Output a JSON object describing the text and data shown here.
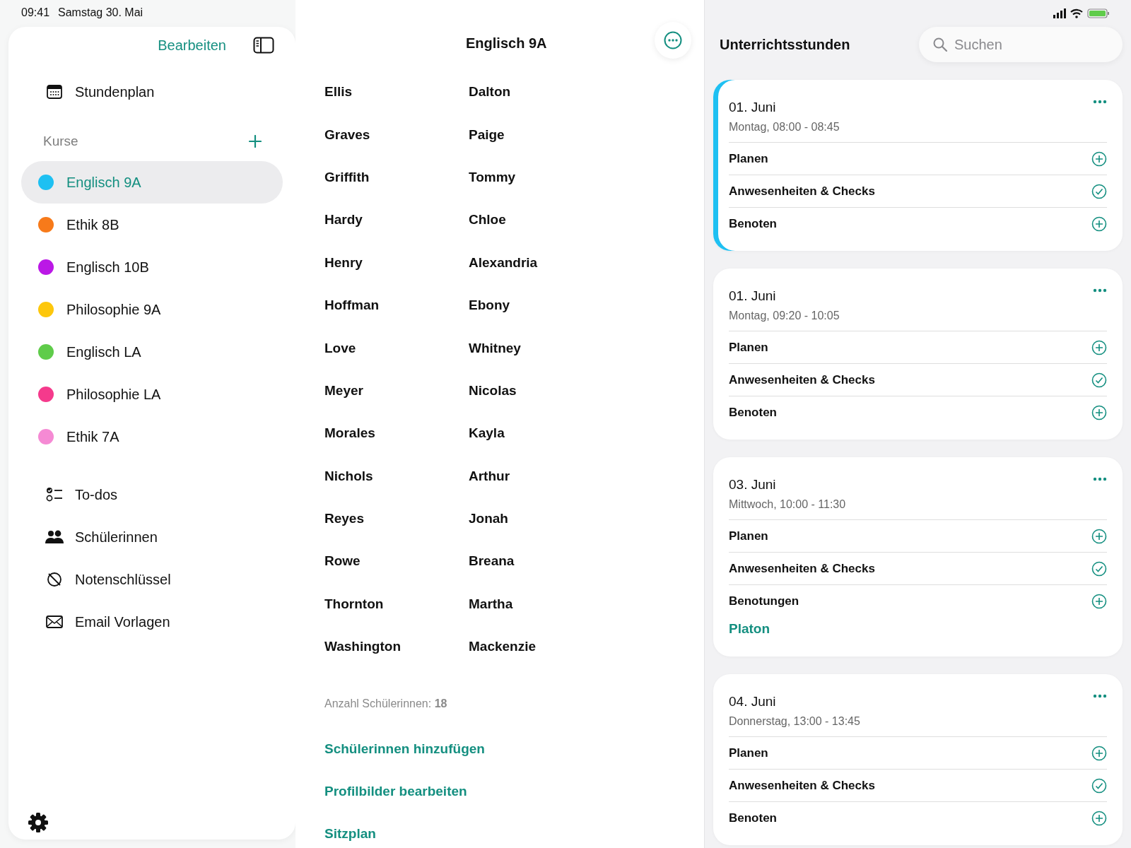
{
  "status_bar": {
    "time": "09:41",
    "date": "Samstag 30. Mai"
  },
  "sidebar": {
    "edit_button": "Bearbeiten",
    "schedule": {
      "label": "Stundenplan"
    },
    "courses_heading": "Kurse",
    "courses": [
      {
        "label": "Englisch 9A",
        "color": "#1ec0f2",
        "selected": true
      },
      {
        "label": "Ethik 8B",
        "color": "#f77a1a",
        "selected": false
      },
      {
        "label": "Englisch 10B",
        "color": "#bb18e6",
        "selected": false
      },
      {
        "label": "Philosophie 9A",
        "color": "#fdc70c",
        "selected": false
      },
      {
        "label": "Englisch LA",
        "color": "#5fcc4a",
        "selected": false
      },
      {
        "label": "Philosophie LA",
        "color": "#f53a8c",
        "selected": false
      },
      {
        "label": "Ethik 7A",
        "color": "#f58ad4",
        "selected": false
      }
    ],
    "nav": [
      {
        "label": "To-dos"
      },
      {
        "label": "Schülerinnen"
      },
      {
        "label": "Notenschlüssel"
      },
      {
        "label": "Email Vorlagen"
      }
    ]
  },
  "course": {
    "title": "Englisch 9A",
    "students": [
      {
        "last": "Ellis",
        "first": "Dalton"
      },
      {
        "last": "Graves",
        "first": "Paige"
      },
      {
        "last": "Griffith",
        "first": "Tommy"
      },
      {
        "last": "Hardy",
        "first": "Chloe"
      },
      {
        "last": "Henry",
        "first": "Alexandria"
      },
      {
        "last": "Hoffman",
        "first": "Ebony"
      },
      {
        "last": "Love",
        "first": "Whitney"
      },
      {
        "last": "Meyer",
        "first": "Nicolas"
      },
      {
        "last": "Morales",
        "first": "Kayla"
      },
      {
        "last": "Nichols",
        "first": "Arthur"
      },
      {
        "last": "Reyes",
        "first": "Jonah"
      },
      {
        "last": "Rowe",
        "first": "Breana"
      },
      {
        "last": "Thornton",
        "first": "Martha"
      },
      {
        "last": "Washington",
        "first": "Mackenzie"
      }
    ],
    "count": "Anzahl Schülerinnen: **18**",
    "links": [
      "Schülerinnen hinzufügen",
      "Profilbilder bearbeiten",
      "Sitzplan"
    ]
  },
  "lessons": {
    "title": "Unterrichtsstunden",
    "search": {
      "placeholder": "Suchen"
    },
    "cards": [
      {
        "date": "01. Juni",
        "time": "Montag, 08:00 - 08:45",
        "selected": true,
        "actions": [
          {
            "label": "Planen",
            "kind": "add"
          },
          {
            "label": "Anwesenheiten & Checks",
            "kind": "check"
          },
          {
            "label": "Benoten",
            "kind": "add"
          }
        ]
      },
      {
        "date": "01. Juni",
        "time": "Montag, 09:20 - 10:05",
        "selected": false,
        "actions": [
          {
            "label": "Planen",
            "kind": "add"
          },
          {
            "label": "Anwesenheiten & Checks",
            "kind": "check"
          },
          {
            "label": "Benoten",
            "kind": "add"
          }
        ]
      },
      {
        "date": "03. Juni",
        "time": "Mittwoch, 10:00 - 11:30",
        "selected": false,
        "actions": [
          {
            "label": "Planen",
            "kind": "add"
          },
          {
            "label": "Anwesenheiten & Checks",
            "kind": "check"
          },
          {
            "label": "Benotungen",
            "kind": "add"
          }
        ],
        "links": [
          "Platon"
        ]
      },
      {
        "date": "04. Juni",
        "time": "Donnerstag, 13:00 - 13:45",
        "selected": false,
        "actions": [
          {
            "label": "Planen",
            "kind": "add"
          },
          {
            "label": "Anwesenheiten & Checks",
            "kind": "check"
          },
          {
            "label": "Benoten",
            "kind": "add"
          }
        ]
      }
    ]
  }
}
